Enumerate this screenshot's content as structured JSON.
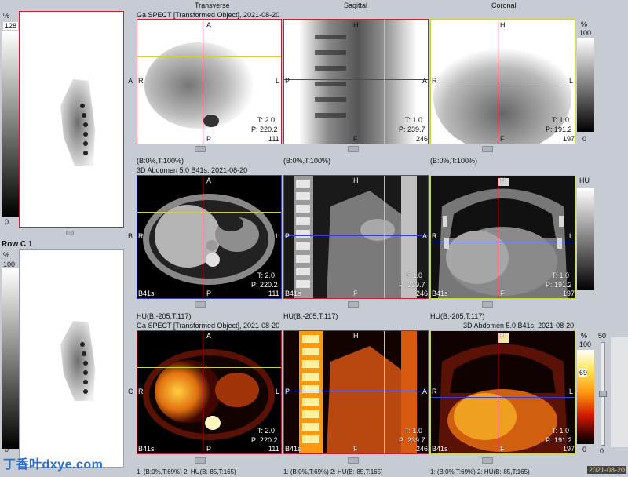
{
  "top_view_headers": [
    "Transverse",
    "Sagittal",
    "Coronal"
  ],
  "left_top": {
    "pct_label": "%",
    "row_tag": "13",
    "max_val": "128",
    "min_val": "0"
  },
  "left_bottom": {
    "row_label": "Row C 1",
    "pct_label": "%",
    "row_tag": "13",
    "max_val": "100",
    "min_val": "0"
  },
  "rows": [
    {
      "letter": "A",
      "title": "Ga SPECT [Transformed Object], 2021-08-20",
      "views": [
        {
          "top": "A",
          "left": "R",
          "right": "L",
          "bottom": "P",
          "t": "T: 2.0",
          "p": "P: 220.2",
          "n": "111",
          "b41s": ""
        },
        {
          "top": "H",
          "left": "P",
          "right": "A",
          "bottom": "F",
          "t": "T: 1.0",
          "p": "P: 239.7",
          "n": "246",
          "b41s": ""
        },
        {
          "top": "H",
          "left": "R",
          "right": "L",
          "bottom": "F",
          "t": "T: 1.0",
          "p": "P: 191.2",
          "n": "197",
          "b41s": ""
        }
      ],
      "window": [
        "(B:0%,T:100%)",
        "(B:0%,T:100%)",
        "(B:0%,T:100%)"
      ],
      "scale": {
        "unit": "%",
        "max": "100",
        "min": "0"
      }
    },
    {
      "letter": "B",
      "title": "3D Abdomen 5.0 B41s, 2021-08-20",
      "views": [
        {
          "top": "A",
          "left": "R",
          "right": "L",
          "bottom": "P",
          "t": "T: 2.0",
          "p": "P: 220.2",
          "n": "111",
          "b41s": "B41s"
        },
        {
          "top": "H",
          "left": "P",
          "right": "A",
          "bottom": "F",
          "t": "T: 1.0",
          "p": "P: 239.7",
          "n": "246",
          "b41s": "B41s"
        },
        {
          "top": "H",
          "left": "R",
          "right": "L",
          "bottom": "F",
          "t": "T: 1.0",
          "p": "P: 191.2",
          "n": "197",
          "b41s": "B41s"
        }
      ],
      "window": [
        "HU(B:-205,T:117)",
        "HU(B:-205,T:117)",
        "HU(B:-205,T:117)"
      ],
      "scale": {
        "unit": "HU",
        "max": "",
        "min": ""
      }
    },
    {
      "letter": "C",
      "title": "Ga SPECT [Transformed Object], 2021-08-20",
      "title2": "3D Abdomen 5.0 B41s, 2021-08-20",
      "views": [
        {
          "top": "A",
          "left": "R",
          "right": "L",
          "bottom": "P",
          "t": "T: 2.0",
          "p": "P: 220.2",
          "n": "111",
          "b41s": "B41s"
        },
        {
          "top": "H",
          "left": "P",
          "right": "A",
          "bottom": "F",
          "t": "T: 1.0",
          "p": "P: 239.7",
          "n": "246",
          "b41s": "B41s"
        },
        {
          "top": "H",
          "left": "R",
          "right": "L",
          "bottom": "F",
          "t": "T: 1.0",
          "p": "P: 191.2",
          "n": "197",
          "b41s": "B41s"
        }
      ],
      "window": [
        "1: (B:0%,T:69%)   2: HU(B:-85,T:165)",
        "1: (B:0%,T:69%)   2: HU(B:-85,T:165)",
        "1: (B:0%,T:69%)   2: HU(B:-85,T:165)"
      ],
      "scale": {
        "unit": "%",
        "max": "100",
        "mid": "69",
        "min": "0"
      },
      "fusion_slider": {
        "top": "50",
        "bottom": "0",
        "value": 0.5
      }
    }
  ],
  "watermark": "丁香叶dxye.com",
  "date_stamp": "2021-08-20",
  "colors": {
    "frame_red": "#c0243a",
    "frame_blue": "#3a3fc0",
    "frame_yellow": "#c8d23c",
    "crosshair_yellow": "#c8d23c",
    "crosshair_blue": "#3040e0"
  }
}
